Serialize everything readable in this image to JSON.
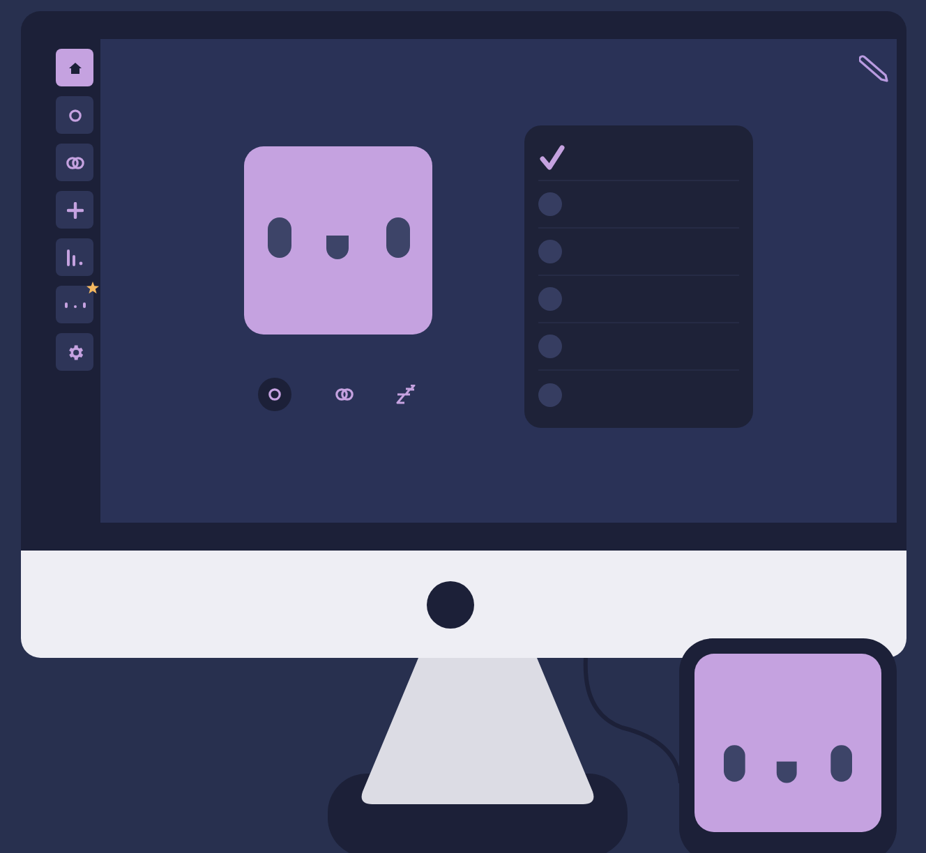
{
  "sidebar": {
    "items": [
      {
        "kind": "home",
        "selected": true,
        "badged": false
      },
      {
        "kind": "circle",
        "selected": false,
        "badged": false
      },
      {
        "kind": "rings",
        "selected": false,
        "badged": false
      },
      {
        "kind": "plus",
        "selected": false,
        "badged": false
      },
      {
        "kind": "bars",
        "selected": false,
        "badged": false
      },
      {
        "kind": "dots",
        "selected": false,
        "badged": true
      },
      {
        "kind": "gear",
        "selected": false,
        "badged": false
      }
    ]
  },
  "pet": {
    "modes": [
      {
        "kind": "circle",
        "selected": true
      },
      {
        "kind": "rings",
        "selected": false
      },
      {
        "kind": "sleep",
        "selected": false
      }
    ]
  },
  "checklist": {
    "items": [
      {
        "checked": true
      },
      {
        "checked": false
      },
      {
        "checked": false
      },
      {
        "checked": false
      },
      {
        "checked": false
      },
      {
        "checked": false
      }
    ]
  }
}
